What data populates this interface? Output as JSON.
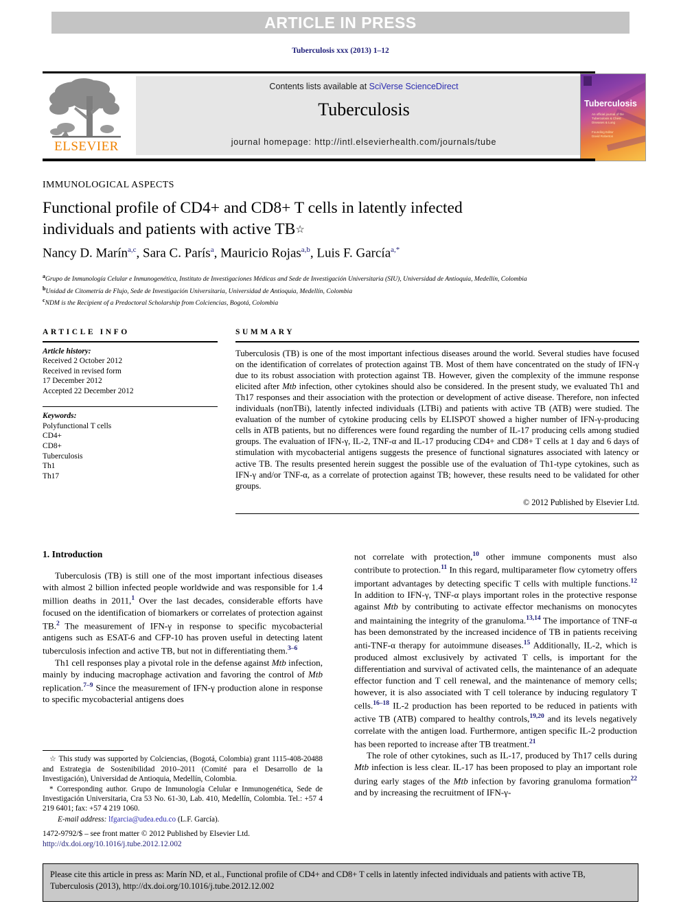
{
  "banner": {
    "text": "ARTICLE IN PRESS"
  },
  "running_head": "Tuberculosis xxx (2013) 1–12",
  "masthead": {
    "contents_prefix": "Contents lists available at ",
    "contents_link": "SciVerse ScienceDirect",
    "journal_name": "Tuberculosis",
    "homepage": "journal homepage: http://intl.elsevierhealth.com/journals/tube",
    "publisher_wordmark": "ELSEVIER",
    "cover": {
      "title": "Tuberculosis",
      "line1": "An official journal of the\nTuberculosis & Chest\nDiseases & Lung",
      "line2": "Founding Editor\nDavid Roberton"
    }
  },
  "section_label": "IMMUNOLOGICAL ASPECTS",
  "title": {
    "line1": "Functional profile of CD4+ and CD8+ T cells in latently infected",
    "line2": "individuals and patients with active TB",
    "footnote_mark": "☆"
  },
  "authors": [
    {
      "name": "Nancy D. Marín",
      "sup": "a,c"
    },
    {
      "name": "Sara C. París",
      "sup": "a"
    },
    {
      "name": "Mauricio Rojas",
      "sup": "a,b"
    },
    {
      "name": "Luis F. García",
      "sup": "a,*"
    }
  ],
  "affiliations": [
    {
      "mark": "a",
      "text": "Grupo de Inmunología Celular e Inmunogenética, Instituto de Investigaciones Médicas and Sede de Investigación Universitaria (SIU), Universidad de Antioquia, Medellín, Colombia"
    },
    {
      "mark": "b",
      "text": "Unidad de Citometría de Flujo, Sede de Investigación Universitaria, Universidad de Antioquia, Medellín, Colombia"
    },
    {
      "mark": "c",
      "text": "NDM is the Recipient of a Predoctoral Scholarship from Colciencias, Bogotá, Colombia"
    }
  ],
  "article_info": {
    "heading": "ARTICLE INFO",
    "history_label": "Article history:",
    "history": [
      "Received 2 October 2012",
      "Received in revised form",
      "17 December 2012",
      "Accepted 22 December 2012"
    ],
    "keywords_label": "Keywords:",
    "keywords": [
      "Polyfunctional T cells",
      "CD4+",
      "CD8+",
      "Tuberculosis",
      "Th1",
      "Th17"
    ]
  },
  "summary": {
    "heading": "SUMMARY",
    "text_parts": [
      "Tuberculosis (TB) is one of the most important infectious diseases around the world. Several studies have focused on the identification of correlates of protection against TB. Most of them have concentrated on the study of IFN-γ due to its robust association with protection against TB. However, given the complexity of the immune response elicited after ",
      "Mtb",
      " infection, other cytokines should also be considered. In the present study, we evaluated Th1 and Th17 responses and their association with the protection or development of active disease. Therefore, non infected individuals (nonTBi), latently infected individuals (LTBi) and patients with active TB (ATB) were studied. The evaluation of the number of cytokine producing cells by ELISPOT showed a higher number of IFN-γ-producing cells in ATB patients, but no differences were found regarding the number of IL-17 producing cells among studied groups. The evaluation of IFN-γ, IL-2, TNF-α and IL-17 producing CD4+ and CD8+ T cells at 1 day and 6 days of stimulation with mycobacterial antigens suggests the presence of functional signatures associated with latency or active TB. The results presented herein suggest the possible use of the evaluation of Th1-type cytokines, such as IFN-γ and/or TNF-α, as a correlate of protection against TB; however, these results need to be validated for other groups."
    ],
    "copyright": "© 2012 Published by Elsevier Ltd."
  },
  "body": {
    "intro_heading": "1. Introduction",
    "left_paragraphs": [
      "Tuberculosis (TB) is still one of the most important infectious diseases with almost 2 billion infected people worldwide and was responsible for 1.4 million deaths in 2011,^1 Over the last decades, considerable efforts have focused on the identification of biomarkers or correlates of protection against TB.^2 The measurement of IFN-γ in response to specific mycobacterial antigens such as ESAT-6 and CFP-10 has proven useful in detecting latent tuberculosis infection and active TB, but not in differentiating them.^3–6",
      "Th1 cell responses play a pivotal role in the defense against Mtb infection, mainly by inducing macrophage activation and favoring the control of Mtb replication.^7–9 Since the measurement of IFN-γ production alone in response to specific mycobacterial antigens does"
    ],
    "right_paragraphs": [
      "not correlate with protection,^10 other immune components must also contribute to protection.^11 In this regard, multiparameter flow cytometry offers important advantages by detecting specific T cells with multiple functions.^12 In addition to IFN-γ, TNF-α plays important roles in the protective response against Mtb by contributing to activate effector mechanisms on monocytes and maintaining the integrity of the granuloma.^13,14 The importance of TNF-α has been demonstrated by the increased incidence of TB in patients receiving anti-TNF-α therapy for autoimmune diseases.^15 Additionally, IL-2, which is produced almost exclusively by activated T cells, is important for the differentiation and survival of activated cells, the maintenance of an adequate effector function and T cell renewal, and the maintenance of memory cells; however, it is also associated with T cell tolerance by inducing regulatory T cells.^16–18 IL-2 production has been reported to be reduced in patients with active TB (ATB) compared to healthy controls,^19,20 and its levels negatively correlate with the antigen load. Furthermore, antigen specific IL-2 production has been reported to increase after TB treatment.^21",
      "The role of other cytokines, such as IL-17, produced by Th17 cells during Mtb infection is less clear. IL-17 has been proposed to play an important role during early stages of the Mtb infection by favoring granuloma formation^22 and by increasing the recruitment of IFN-γ-"
    ]
  },
  "footnotes": {
    "funding_mark": "☆",
    "funding": "This study was supported by Colciencias, (Bogotá, Colombia) grant 1115-408-20488 and Estrategia de Sostenibilidad 2010–2011 (Comité para el Desarrollo de la Investigación), Universidad de Antioquia, Medellín, Colombia.",
    "corresponding_mark": "*",
    "corresponding": "Corresponding author. Grupo de Inmunología Celular e Inmunogenética, Sede de Investigación Universitaria, Cra 53 No. 61-30, Lab. 410, Medellín, Colombia. Tel.: +57 4 219 6401; fax: +57 4 219 1060.",
    "email_label": "E-mail address:",
    "email": "lfgarcia@udea.edu.co",
    "email_suffix": "(L.F. García)."
  },
  "issn_footer": {
    "line1": "1472-9792/$ – see front matter © 2012 Published by Elsevier Ltd.",
    "doi": "http://dx.doi.org/10.1016/j.tube.2012.12.002"
  },
  "citation_box": {
    "text": "Please cite this article in press as: Marín ND, et al., Functional profile of CD4+ and CD8+ T cells in latently infected individuals and patients with active TB, Tuberculosis (2013), http://dx.doi.org/10.1016/j.tube.2012.12.002"
  },
  "colors": {
    "banner_bg": "#c4c4c4",
    "link_blue": "#2b2bb0",
    "running_head_blue": "#20207a",
    "elsevier_orange": "#ef8200",
    "contents_bg": "#e6e6e6",
    "cite_box_bg": "#c9c9c9"
  }
}
